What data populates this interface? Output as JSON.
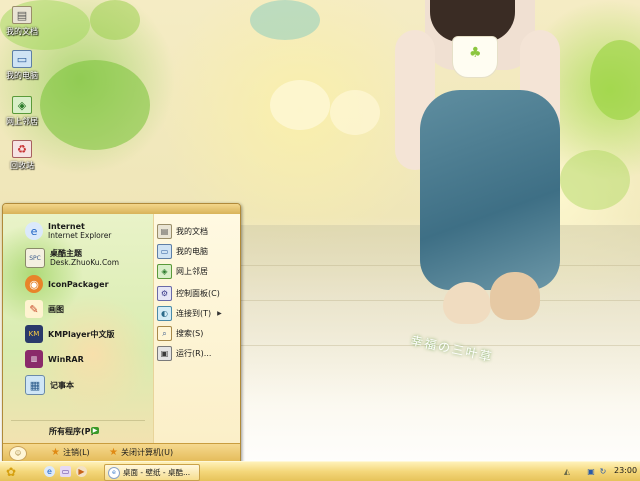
{
  "desktop": {
    "icons": [
      {
        "label": "我的文档",
        "icon": "my-documents-icon"
      },
      {
        "label": "我的电脑",
        "icon": "my-computer-icon"
      },
      {
        "label": "网上邻居",
        "icon": "network-places-icon"
      },
      {
        "label": "回收站",
        "icon": "recycle-bin-icon"
      }
    ],
    "wallpaper_text": "幸福の三叶草"
  },
  "start_menu": {
    "left_items": [
      {
        "title": "Internet",
        "subtitle": "Internet Explorer",
        "icon": "internet-explorer-icon"
      },
      {
        "title": "桌酷主题",
        "subtitle": "Desk.ZhuoKu.Com",
        "icon": "zhuoku-icon"
      },
      {
        "title": "IconPackager",
        "subtitle": "",
        "icon": "iconpackager-icon"
      },
      {
        "title": "画图",
        "subtitle": "",
        "icon": "paint-icon"
      },
      {
        "title": "KMPlayer中文版",
        "subtitle": "",
        "icon": "kmplayer-icon"
      },
      {
        "title": "WinRAR",
        "subtitle": "",
        "icon": "winrar-icon"
      },
      {
        "title": "记事本",
        "subtitle": "",
        "icon": "notepad-icon"
      }
    ],
    "all_programs": "所有程序(P)",
    "right_items": [
      {
        "label": "我的文档",
        "icon": "my-documents-icon",
        "arrow": false
      },
      {
        "label": "我的电脑",
        "icon": "my-computer-icon",
        "arrow": false
      },
      {
        "label": "网上邻居",
        "icon": "network-places-icon",
        "arrow": false
      },
      {
        "label": "控制面板(C)",
        "icon": "control-panel-icon",
        "arrow": false
      },
      {
        "label": "连接到(T)",
        "icon": "connect-to-icon",
        "arrow": true
      },
      {
        "label": "搜索(S)",
        "icon": "search-icon",
        "arrow": false
      },
      {
        "label": "运行(R)...",
        "icon": "run-icon",
        "arrow": false
      }
    ],
    "logoff": "注销(L)",
    "shutdown": "关闭计算机(U)"
  },
  "taskbar": {
    "start_icon": "start-flower-icon",
    "quick_launch": [
      "internet-explorer-icon",
      "show-desktop-icon",
      "media-player-icon"
    ],
    "task_label": "桌面 - 壁纸 - 桌酷...",
    "clock": "23:00",
    "tray_icons": [
      "volume-icon",
      "network-icon",
      "sync-icon"
    ]
  },
  "colors": {
    "taskbar": "#f4d77a",
    "start_menu_border": "#b08a3a",
    "accent_green": "#8cc63f"
  }
}
